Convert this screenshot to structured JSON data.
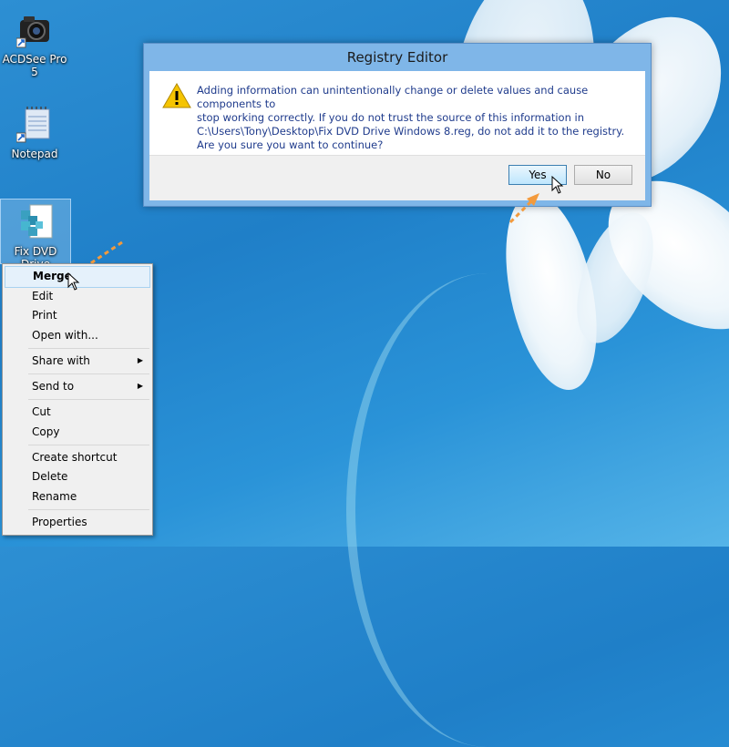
{
  "desktop": {
    "icons": [
      {
        "label": "ACDSee Pro 5",
        "icon": "acdsee-camera-icon"
      },
      {
        "label": "Notepad",
        "icon": "notepad-icon"
      },
      {
        "label": "Fix DVD Drive",
        "icon": "registry-file-icon"
      }
    ]
  },
  "dialog": {
    "title": "Registry Editor",
    "warning_icon": "warning-triangle-icon",
    "message_line1": "Adding information can unintentionally change or delete values and cause components to",
    "message_line2": "stop working correctly. If you do not trust the source of this information in",
    "message_line3": "C:\\Users\\Tony\\Desktop\\Fix DVD Drive Windows 8.reg, do not add it to the registry.",
    "question": "Are you sure you want to continue?",
    "yes_label": "Yes",
    "no_label": "No"
  },
  "context_menu": {
    "items": [
      {
        "label": "Merge",
        "highlighted": true
      },
      {
        "label": "Edit"
      },
      {
        "label": "Print"
      },
      {
        "label": "Open with..."
      },
      {
        "label": "Share with",
        "submenu": true
      },
      {
        "label": "Send to",
        "submenu": true
      },
      {
        "label": "Cut"
      },
      {
        "label": "Copy"
      },
      {
        "label": "Create shortcut"
      },
      {
        "label": "Delete"
      },
      {
        "label": "Rename"
      },
      {
        "label": "Properties"
      }
    ]
  },
  "colors": {
    "accent_orange": "#f39a3c",
    "dialog_frame": "#7fb6e8",
    "desktop_blue": "#2489d0"
  }
}
